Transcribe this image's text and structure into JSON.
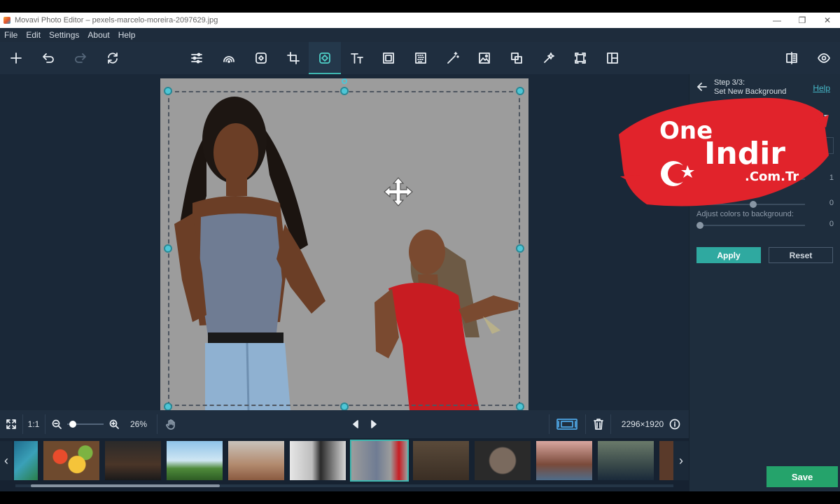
{
  "window": {
    "title": "Movavi Photo Editor – pexels-marcelo-moreira-2097629.jpg",
    "minimize": "—",
    "maximize": "❐",
    "close": "✕"
  },
  "menu": [
    "File",
    "Edit",
    "Settings",
    "About",
    "Help"
  ],
  "toolbar": {
    "left": [
      "add-icon",
      "undo-icon",
      "redo-icon",
      "reset-icon"
    ],
    "tools": [
      "adjust-icon",
      "filters-icon",
      "retouch-icon",
      "crop-icon",
      "remove-background-icon",
      "text-icon",
      "frames-icon",
      "noise-icon",
      "magic-wand-icon",
      "insert-image-icon",
      "object-removal-icon",
      "auto-enhance-icon",
      "resize-icon",
      "collage-icon"
    ],
    "active_tool": "remove-background-icon",
    "right": [
      "compare-icon",
      "preview-icon"
    ]
  },
  "side_panel": {
    "step_line1": "Step 3/3:",
    "step_line2": "Set New Background",
    "help": "Help",
    "background_color": "#f08b1a",
    "slider1_value": "1",
    "slider2_value": "0",
    "adjust_label": "Adjust colors to background:",
    "slider3_value": "0",
    "apply": "Apply",
    "reset": "Reset",
    "save": "Save"
  },
  "status": {
    "fit": "fit-screen-icon",
    "actual_size": "1:1",
    "zoom_value": 0.06,
    "zoom": "26%",
    "dimensions": "2296×1920",
    "info": "info-icon"
  },
  "filmstrip": {
    "thumb_count": 11,
    "selected_index": 5
  },
  "watermark": {
    "one": "One",
    "indir": "Indir",
    "domain": ".Com.Tr"
  }
}
